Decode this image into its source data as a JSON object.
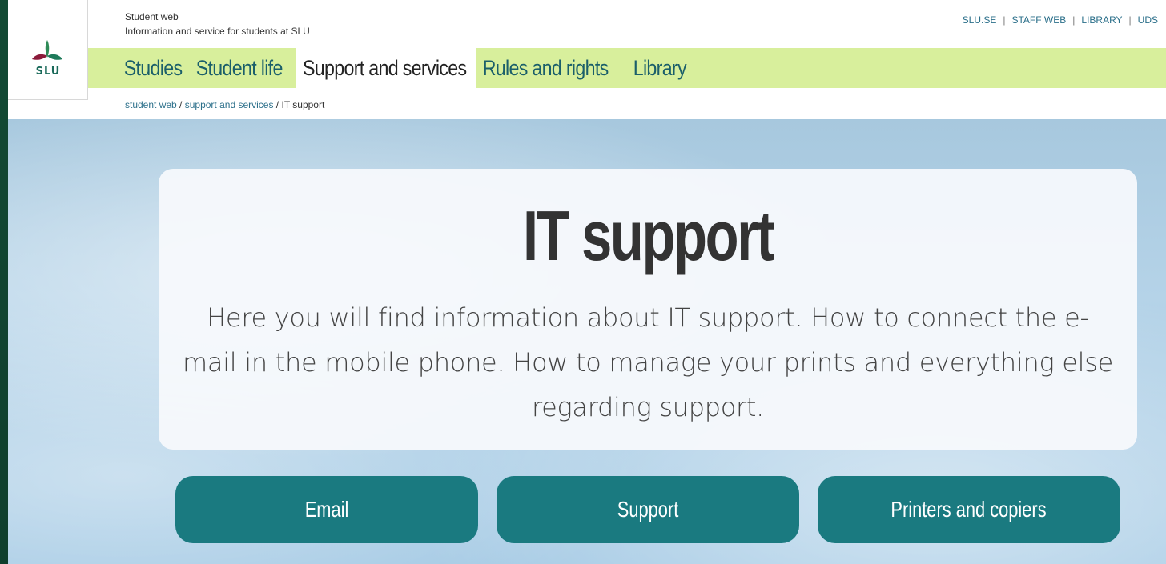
{
  "header": {
    "logo_text": "SLU",
    "site_title": "Student web",
    "site_subtitle": "Information and service for students at SLU",
    "top_links": [
      "SLU.SE",
      "STAFF WEB",
      "LIBRARY",
      "UDS"
    ],
    "top_link_separator": "|"
  },
  "nav": {
    "items": [
      {
        "label": "Studies",
        "active": false
      },
      {
        "label": "Student life",
        "active": false
      },
      {
        "label": "Support and services",
        "active": true
      },
      {
        "label": "Rules and rights",
        "active": false
      },
      {
        "label": "Library",
        "active": false
      }
    ]
  },
  "breadcrumb": {
    "crumb1": "student web",
    "crumb2": "support and services",
    "current": "IT support",
    "separator": " / "
  },
  "hero": {
    "title": "IT support",
    "description": "Here you will find information about IT support. How to connect the e-mail in the mobile phone. How to manage your prints and everything else regarding support."
  },
  "buttons": {
    "email": "Email",
    "support": "Support",
    "printers": "Printers and copiers"
  },
  "colors": {
    "nav_background": "#d8ef9c",
    "button_background": "#1a7a80",
    "link_color": "#2b6f8a",
    "frame_green": "#0f3d2c"
  }
}
